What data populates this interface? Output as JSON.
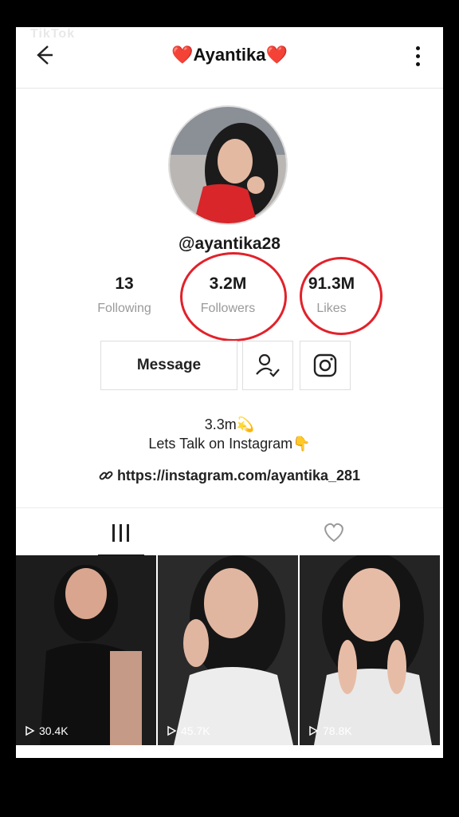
{
  "watermark": {
    "brand": "TikTok",
    "sub": ""
  },
  "header": {
    "title": "Ayantika",
    "heart_left": "❤️",
    "heart_right": "❤️"
  },
  "profile": {
    "username": "@ayantika28"
  },
  "stats": [
    {
      "value": "13",
      "label": "Following"
    },
    {
      "value": "3.2M",
      "label": "Followers"
    },
    {
      "value": "91.3M",
      "label": "Likes"
    }
  ],
  "actions": {
    "message_label": "Message"
  },
  "bio": {
    "line1": "3.3m💫",
    "line2": "Lets Talk on Instagram👇",
    "link": "https://instagram.com/ayantika_281"
  },
  "videos": [
    {
      "views": "30.4K"
    },
    {
      "views": "45.7K"
    },
    {
      "views": "78.8K"
    }
  ],
  "colors": {
    "accent_red": "#e2212a",
    "heart": "#c3171b"
  },
  "icons": [
    "back-arrow-icon",
    "more-vertical-icon",
    "follow-check-icon",
    "instagram-icon",
    "link-icon",
    "grid-icon",
    "heart-outline-icon",
    "play-icon"
  ]
}
